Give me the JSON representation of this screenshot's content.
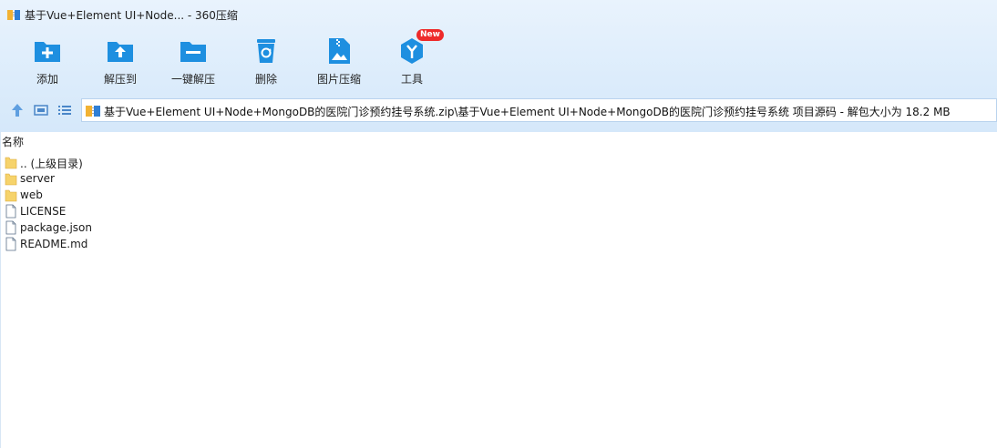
{
  "window": {
    "title": "基于Vue+Element UI+Node... - 360压缩"
  },
  "toolbar": {
    "items": [
      {
        "label": "添加",
        "icon": "add-folder-icon"
      },
      {
        "label": "解压到",
        "icon": "extract-to-icon"
      },
      {
        "label": "一键解压",
        "icon": "one-click-extract-icon"
      },
      {
        "label": "删除",
        "icon": "trash-icon"
      },
      {
        "label": "图片压缩",
        "icon": "image-compress-icon"
      },
      {
        "label": "工具",
        "icon": "tools-icon",
        "badge": "New"
      }
    ]
  },
  "address": {
    "path": "基于Vue+Element UI+Node+MongoDB的医院门诊预约挂号系统.zip\\基于Vue+Element UI+Node+MongoDB的医院门诊预约挂号系统 项目源码 - 解包大小为 18.2 MB"
  },
  "list": {
    "column_name": "名称",
    "items": [
      {
        "name": ".. (上级目录)",
        "type": "folder"
      },
      {
        "name": "server",
        "type": "folder"
      },
      {
        "name": "web",
        "type": "folder"
      },
      {
        "name": "LICENSE",
        "type": "file"
      },
      {
        "name": "package.json",
        "type": "file"
      },
      {
        "name": "README.md",
        "type": "file"
      }
    ]
  },
  "colors": {
    "accent": "#1e8fe0",
    "chrome_bg": "#dcecfb",
    "folder": "#f6d36b",
    "badge": "#ee2a2a"
  }
}
